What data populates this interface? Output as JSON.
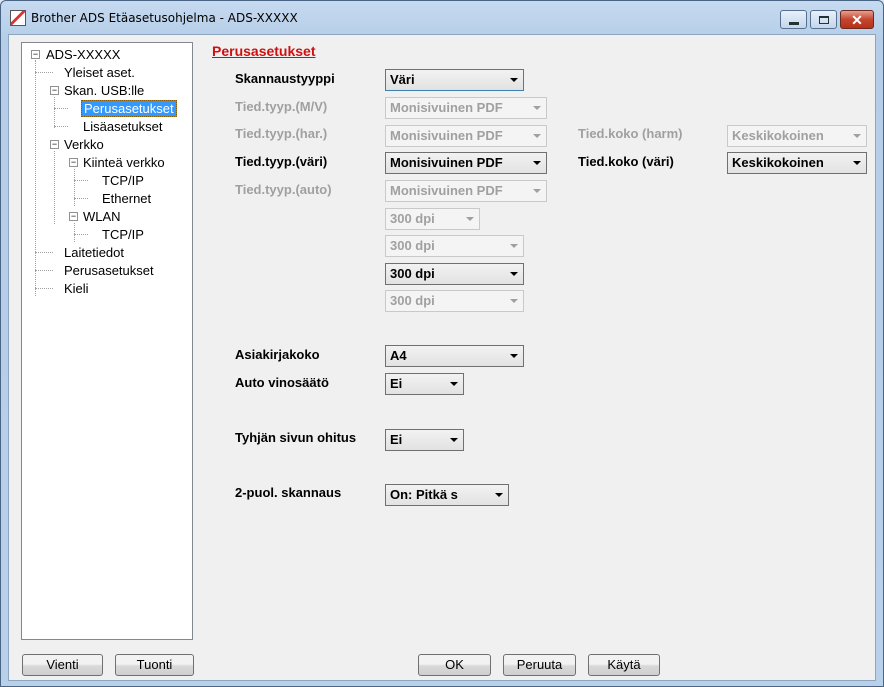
{
  "window": {
    "title": "Brother ADS Etäasetusohjelma - ADS-XXXXX"
  },
  "tree": {
    "root": "ADS-XXXXX",
    "general": "Yleiset aset.",
    "scan_usb": "Skan. USB:lle",
    "basic": "Perusasetukset",
    "advanced": "Lisäasetukset",
    "network": "Verkko",
    "wired": "Kiinteä verkko",
    "wired_tcpip": "TCP/IP",
    "ethernet": "Ethernet",
    "wlan": "WLAN",
    "wlan_tcpip": "TCP/IP",
    "device_info": "Laitetiedot",
    "initial_setup": "Perusasetukset",
    "language": "Kieli"
  },
  "panel": {
    "title": "Perusasetukset",
    "scan_type_label": "Skannaustyyppi",
    "scan_type_value": "Väri",
    "ft_bw_label": "Tied.tyyp.(M/V)",
    "ft_bw_value": "Monisivuinen PDF",
    "ft_gray_label": "Tied.tyyp.(har.)",
    "ft_gray_value": "Monisivuinen PDF",
    "fs_gray_label": "Tied.koko (harm)",
    "fs_gray_value": "Keskikokoinen",
    "ft_color_label": "Tied.tyyp.(väri)",
    "ft_color_value": "Monisivuinen PDF",
    "fs_color_label": "Tied.koko (väri)",
    "fs_color_value": "Keskikokoinen",
    "ft_auto_label": "Tied.tyyp.(auto)",
    "ft_auto_value": "Monisivuinen PDF",
    "res_bw": "300 dpi",
    "res_gray": "300 dpi",
    "res_color": "300 dpi",
    "res_auto": "300 dpi",
    "doc_size_label": "Asiakirjakoko",
    "doc_size_value": "A4",
    "deskew_label": "Auto vinosäätö",
    "deskew_value": "Ei",
    "skip_blank_label": "Tyhjän sivun ohitus",
    "skip_blank_value": "Ei",
    "duplex_label": "2-puol. skannaus",
    "duplex_value": "On: Pitkä s"
  },
  "buttons": {
    "export": "Vienti",
    "import": "Tuonti",
    "ok": "OK",
    "cancel": "Peruuta",
    "apply": "Käytä"
  },
  "colors": {
    "title_red": "#d01010",
    "selection": "#3399ff"
  }
}
